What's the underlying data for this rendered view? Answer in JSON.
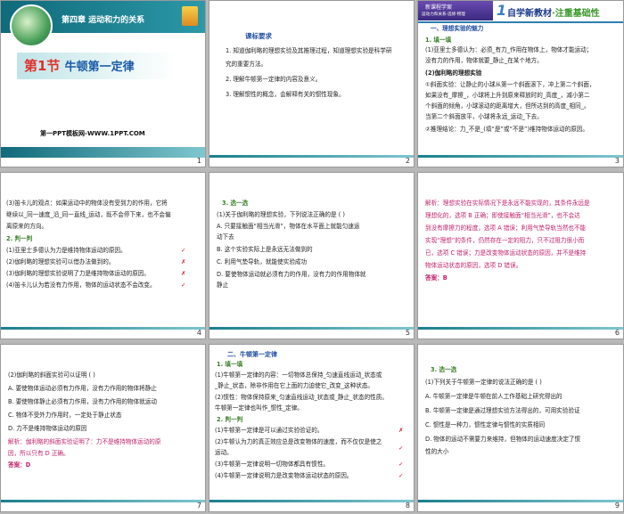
{
  "slides": [
    {
      "num": "1",
      "chapter": "第四章  运动和力的关系",
      "title_a": "第1节",
      "title_b": "牛顿第一定律",
      "credit": "第一PPT模板网-WWW.1PPT.COM"
    },
    {
      "num": "2",
      "heading": "课标要求",
      "lines": [
        "1. 知道伽利略的理想实验及其推理过程，知道理想实验是科学研",
        "    究的重要方法。",
        "2. 理解牛顿第一定律的内容及意义。",
        "3. 理解惯性的概念，会解释有关的惯性现象。"
      ]
    },
    {
      "num": "3",
      "badge_top": "新课程学案",
      "badge_sub": "运动力和关系·选修·物理",
      "section_num": "1",
      "section_title": "自学新教材",
      "section_sub": "·注重基础性",
      "sub_heading": "一、理想实验的魅力",
      "lines": [
        "1. 填一填",
        "(1)亚里士多德认为：必须_有力_作用在物体上，物体才能运动；",
        "   没有力的作用，物体就要_静止_在某个地方。",
        "(2)伽利略的理想实验",
        "  ①斜面实验：让静止的小球从第一个斜面滚下，冲上第二个斜面，",
        "  如果没有_摩擦_，小球将上升到原来释放时的_高度_，减小第二",
        "  个斜面的倾角，小球滚动的距离增大，但所达到的高度_相同_。",
        "  当第二个斜面放平，小球将永远_运动_下去。",
        "  ②推理结论：力_不是_(填“是”或“不是”)维持物体运动的原因。"
      ]
    },
    {
      "num": "4",
      "lines": [
        "(3)笛卡儿的观点：如果运动中的物体没有受到力的作用，它将",
        "   继续以_同一速度_沿_同一直线_运动，既不会停下来，也不会偏",
        "   离原来的方向。",
        "2. 判一判",
        "(1)亚里士多德认为力是维持物体运动的原因。",
        "(2)伽利略的理想实验可以借办法做到的。",
        "(3)伽利略的理想实验说明了力是维持物体运动的原因。",
        "(4)笛卡儿认为若没有力作用，物体的运动状态不会改变。"
      ],
      "marks": [
        "✓",
        "✗",
        "✗",
        "✓"
      ]
    },
    {
      "num": "5",
      "lines": [
        "3. 选一选",
        "(1)关于伽利略的理想实验，下列说法正确的是      (    )",
        "  A. 只要接触面“相当光滑”，物体在水平面上就能匀速运",
        "     动下去",
        "  B. 这个实验实际上是永远无法做到的",
        "  C. 利用气垫导轨，就能使实验成功",
        "  D. 要使物体运动就必须有力的作用，没有力的作用物体就",
        "     静止"
      ]
    },
    {
      "num": "6",
      "lines": [
        "解析：理想实验在实际情况下是永远不能实现的，其条件永远是",
        "理想化的，选项 B 正确；即使接触面“相当光滑”，也不会达",
        "到没有摩擦力的程度，选项 A 错误；利用气垫导轨当然也不能",
        "实现“理想”的条件，仍然存在一定的阻力，只不过阻力很小而",
        "已，选项 C 错误；力是改变物体运动状态的原因，并不是维持",
        "物体运动状态的原因，选项 D 错误。",
        "答案：B"
      ]
    },
    {
      "num": "7",
      "lines": [
        "(2)伽利略的斜面实验可以证明            (    )",
        "  A. 要使物体运动必须有力作用，没有力作用的物体将静止",
        "  B. 要使物体静止必须有力作用，没有力作用的物体就运动",
        "  C. 物体不受外力作用时，一定处于静止状态",
        "  D. 力不是维持物体运动的原因",
        "解析：伽利略的斜面实验证明了：力不是维持物体运动的原",
        "因，所以只有 D 正确。",
        "答案：D"
      ]
    },
    {
      "num": "8",
      "heading": "二、牛顿第一定律",
      "lines": [
        "1. 填一填",
        "(1)牛顿第一定律的内容：一切物体总保持_匀速直线运动_状态或",
        "   _静止_状态，除非作用在它上面的力迫使它_改变_这种状态。",
        "(2)惯性：物体保持原来_匀速直线运动_状态或_静止_状态的性质。",
        "   牛顿第一定律也叫作_惯性_定律。",
        "2. 判一判",
        "(1)牛顿第一定律是可以通过实验验证的。",
        "(2)牛顿认为力的真正效应总是改变物体的速度，而不仅仅是使之",
        "   运动。",
        "(3)牛顿第一定律说明一切物体都具有惯性。",
        "(4)牛顿第一定律说明力是改变物体运动状态的原因。"
      ],
      "marks": [
        "✗",
        "✓",
        "✓",
        "✓"
      ]
    },
    {
      "num": "9",
      "lines": [
        "3. 选一选",
        "(1)下列关于牛顿第一定律的说法正确的是          (    )",
        "  A. 牛顿第一定律是牛顿在前人工作基础上研究得出的",
        "  B. 牛顿第一定律是通过理想实验方法得出的，可用实验验证",
        "  C. 惯性是一种力，惯性定律与惯性的实质相同",
        "  D. 物体的运动不需要力来维持，但物体的运动速度决定了惯",
        "     性的大小"
      ]
    }
  ]
}
